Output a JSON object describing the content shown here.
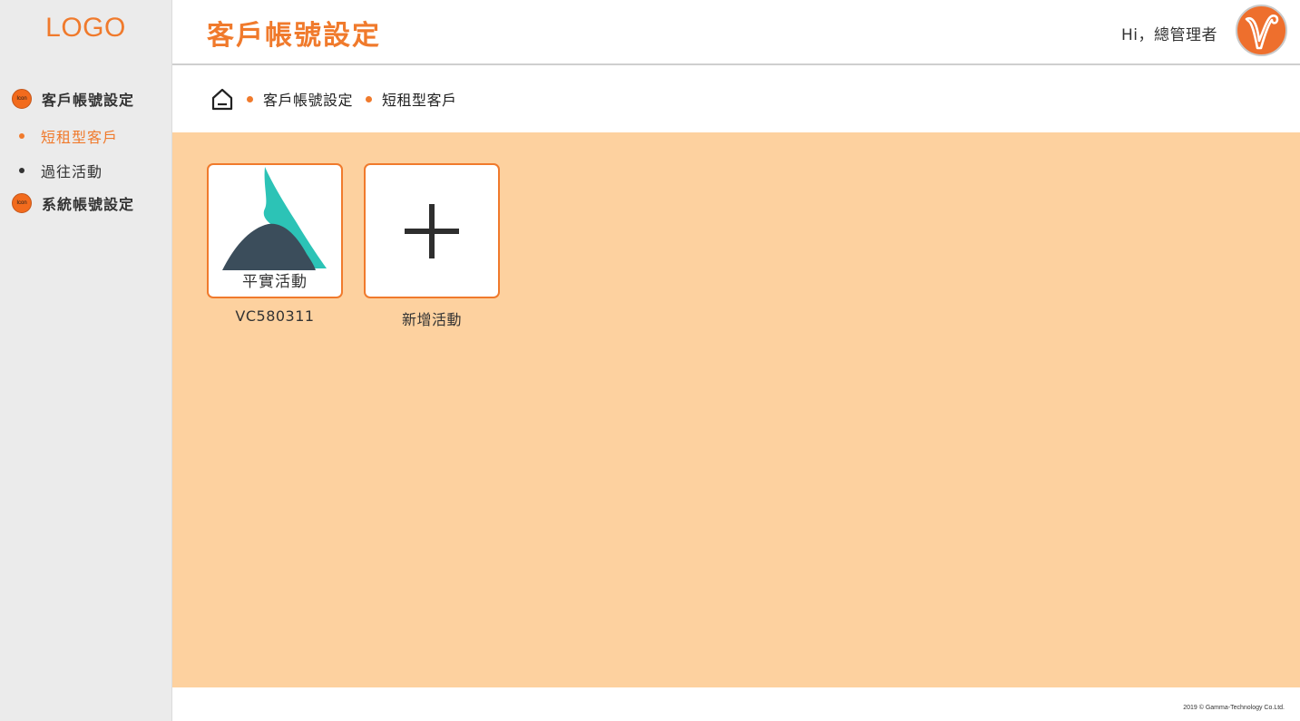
{
  "app": {
    "logo": "LOGO",
    "page_title": "客戶帳號設定",
    "greeting": "Hi，總管理者"
  },
  "sidebar": {
    "items": [
      {
        "type": "group",
        "label": "客戶帳號設定",
        "icon_text": "Icon",
        "icon": "circle-icon"
      },
      {
        "type": "sub",
        "label": "短租型客戶",
        "active": true
      },
      {
        "type": "sub",
        "label": "過往活動",
        "active": false
      },
      {
        "type": "group",
        "label": "系統帳號設定",
        "icon_text": "Icon",
        "icon": "circle-icon"
      }
    ]
  },
  "breadcrumb": {
    "home_icon": "home-icon",
    "items": [
      "客戶帳號設定",
      "短租型客戶"
    ]
  },
  "cards": [
    {
      "inner_label": "平實活動",
      "caption": "VC580311",
      "icon": "mountain-logo"
    },
    {
      "caption": "新增活動",
      "icon": "plus-icon"
    }
  ],
  "footer": {
    "copyright": "2019 ©  Gamma-Technology Co.Ltd."
  },
  "colors": {
    "accent": "#f07a2c",
    "content_bg": "#fdd19f",
    "sidebar_bg": "#ebebeb"
  }
}
